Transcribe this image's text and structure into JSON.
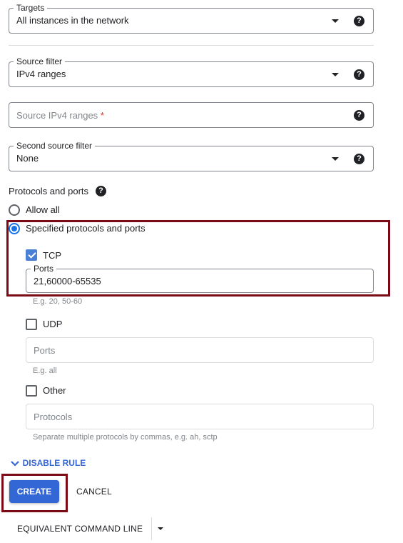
{
  "targets": {
    "label": "Targets",
    "value": "All instances in the network"
  },
  "source_filter": {
    "label": "Source filter",
    "value": "IPv4 ranges"
  },
  "source_ranges": {
    "placeholder": "Source IPv4 ranges",
    "required_mark": "*"
  },
  "second_source_filter": {
    "label": "Second source filter",
    "value": "None"
  },
  "protocols": {
    "heading": "Protocols and ports",
    "options": [
      {
        "label": "Allow all",
        "selected": false
      },
      {
        "label": "Specified protocols and ports",
        "selected": true
      }
    ],
    "tcp": {
      "label": "TCP",
      "checked": true,
      "ports_label": "Ports",
      "ports_value": "21,60000-65535",
      "hint": "E.g. 20, 50-60"
    },
    "udp": {
      "label": "UDP",
      "checked": false,
      "ports_placeholder": "Ports",
      "hint": "E.g. all"
    },
    "other": {
      "label": "Other",
      "checked": false,
      "protocols_placeholder": "Protocols",
      "hint": "Separate multiple protocols by commas, e.g. ah, sctp"
    }
  },
  "disable_rule": {
    "label": "DISABLE RULE"
  },
  "actions": {
    "create": "CREATE",
    "cancel": "CANCEL",
    "command_line": "EQUIVALENT COMMAND LINE"
  },
  "help_glyph": "?",
  "colors": {
    "primary": "#3367d6",
    "highlight": "#7b0a16",
    "required": "#d93025"
  }
}
